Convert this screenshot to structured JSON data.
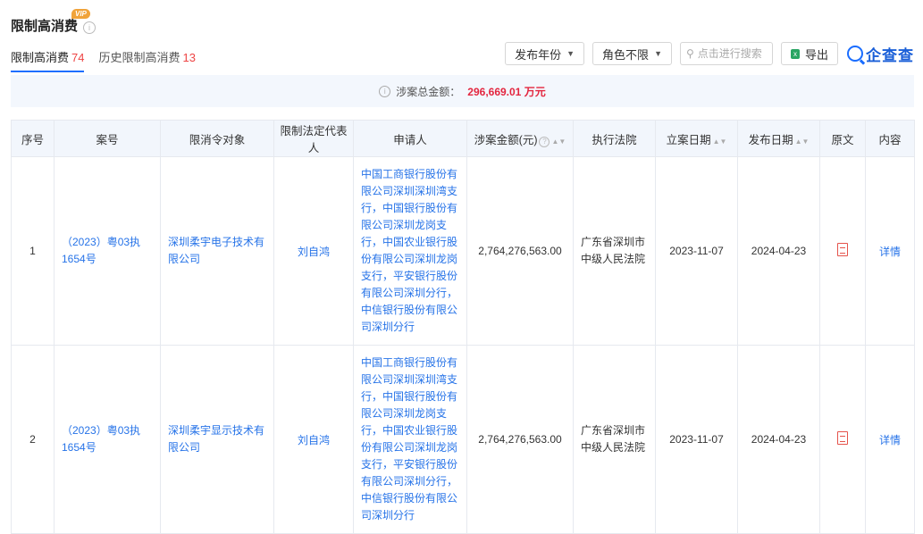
{
  "header": {
    "title": "限制高消费",
    "vip_badge": "VIP",
    "info_icon": "i"
  },
  "tabs": [
    {
      "label": "限制高消费",
      "count": "74"
    },
    {
      "label": "历史限制高消费",
      "count": "13"
    }
  ],
  "toolbar": {
    "year_filter": "发布年份",
    "role_filter": "角色不限",
    "search_placeholder": "点击进行搜索",
    "export_label": "导出"
  },
  "brand": {
    "name": "企查查",
    "color": "#1a5fd8"
  },
  "summary": {
    "label": "涉案总金额：",
    "amount": "296,669.01 万元",
    "amount_color": "#e3263f"
  },
  "table": {
    "columns": [
      "序号",
      "案号",
      "限消令对象",
      "限制法定代表人",
      "申请人",
      "涉案金额(元)",
      "执行法院",
      "立案日期",
      "发布日期",
      "原文",
      "内容"
    ],
    "rows": [
      {
        "index": "1",
        "case_no": "（2023）粤03执1654号",
        "target": "深圳柔宇电子技术有限公司",
        "legal_rep": "刘自鸿",
        "applicant": "中国工商银行股份有限公司深圳深圳湾支行，中国银行股份有限公司深圳龙岗支行，中国农业银行股份有限公司深圳龙岗支行，平安银行股份有限公司深圳分行，中信银行股份有限公司深圳分行",
        "amount": "2,764,276,563.00",
        "court": "广东省深圳市中级人民法院",
        "filing_date": "2023-11-07",
        "publish_date": "2024-04-23",
        "detail": "详情"
      },
      {
        "index": "2",
        "case_no": "（2023）粤03执1654号",
        "target": "深圳柔宇显示技术有限公司",
        "legal_rep": "刘自鸿",
        "applicant": "中国工商银行股份有限公司深圳深圳湾支行，中国银行股份有限公司深圳龙岗支行，中国农业银行股份有限公司深圳龙岗支行，平安银行股份有限公司深圳分行，中信银行股份有限公司深圳分行",
        "amount": "2,764,276,563.00",
        "court": "广东省深圳市中级人民法院",
        "filing_date": "2023-11-07",
        "publish_date": "2024-04-23",
        "detail": "详情"
      }
    ]
  }
}
